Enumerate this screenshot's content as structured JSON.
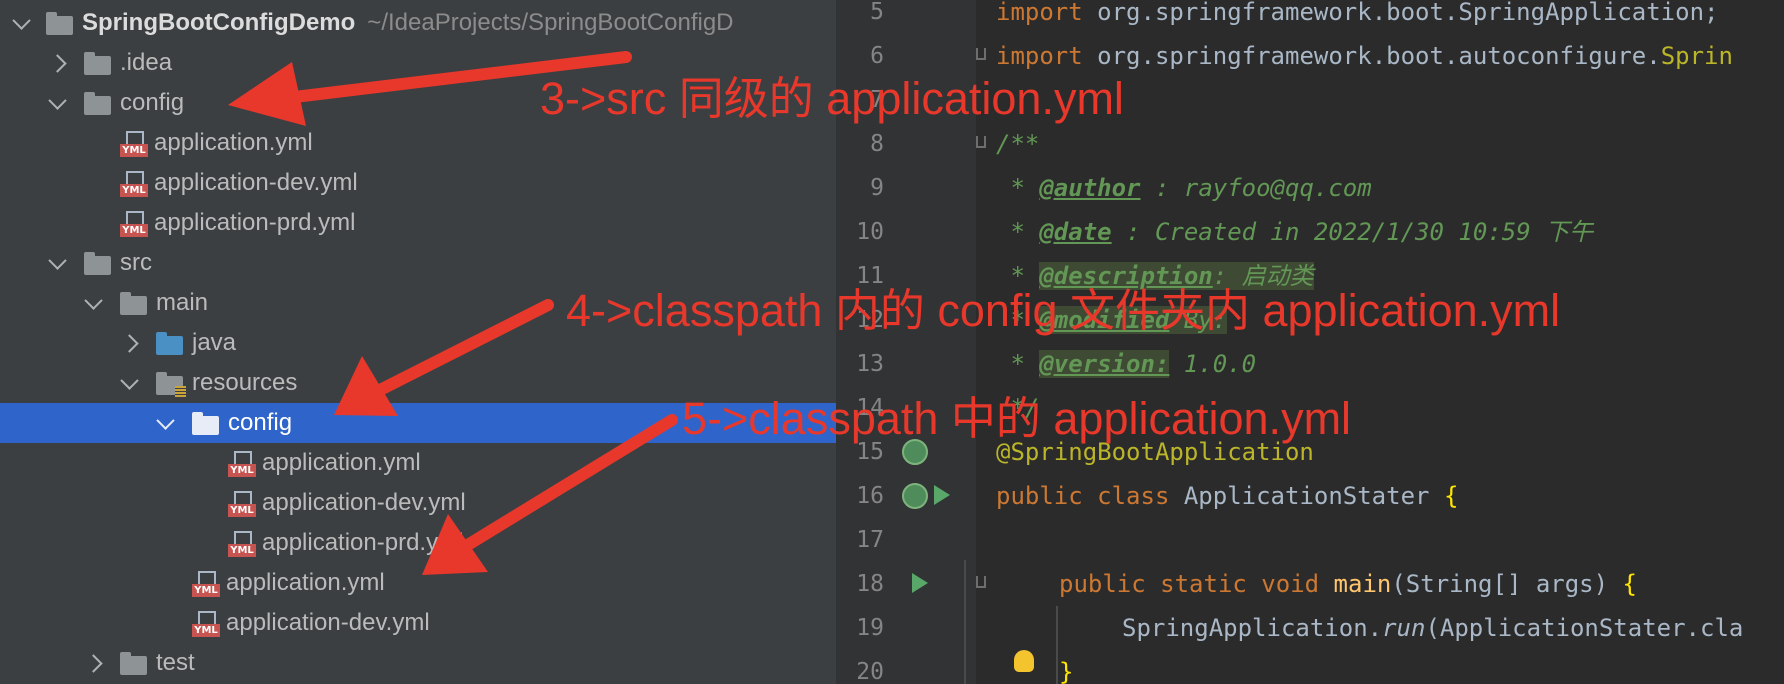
{
  "project_tree": {
    "root": {
      "name": "SpringBootConfigDemo",
      "path": "~/IdeaProjects/SpringBootConfigD"
    },
    "items": [
      {
        "label": ".idea"
      },
      {
        "label": "config"
      },
      {
        "label": "application.yml"
      },
      {
        "label": "application-dev.yml"
      },
      {
        "label": "application-prd.yml"
      },
      {
        "label": "src"
      },
      {
        "label": "main"
      },
      {
        "label": "java"
      },
      {
        "label": "resources"
      },
      {
        "label": "config"
      },
      {
        "label": "application.yml"
      },
      {
        "label": "application-dev.yml"
      },
      {
        "label": "application-prd.yml"
      },
      {
        "label": "application.yml"
      },
      {
        "label": "application-dev.yml"
      },
      {
        "label": "test"
      }
    ]
  },
  "editor": {
    "line_numbers": [
      "5",
      "6",
      "7",
      "8",
      "9",
      "10",
      "11",
      "12",
      "13",
      "14",
      "15",
      "16",
      "17",
      "18",
      "19",
      "20"
    ],
    "lines": {
      "l5a": "import ",
      "l5b": "org.springframework.boot.SpringApplication;",
      "l6a": "import ",
      "l6b": "org.springframework.boot.autoconfigure.",
      "l6c": "Sprin",
      "l8": "/**",
      "l9a": " * ",
      "l9b": "@author",
      "l9c": " : rayfoo@qq.com",
      "l10a": " * ",
      "l10b": "@date",
      "l10c": " : Created in 2022/1/30 10:59 下午",
      "l11a": " * ",
      "l11b": "@description",
      "l11c": ": 启动类",
      "l12a": " * ",
      "l12b": "@modified",
      "l12c": " By:",
      "l13a": " * ",
      "l13b": "@version:",
      "l13c": " 1.0.0",
      "l14": " */",
      "l15": "@SpringBootApplication",
      "l16a": "public class ",
      "l16b": "ApplicationStater ",
      "l16c": "{",
      "l18a": "public static void ",
      "l18b": "main",
      "l18c": "(String[] args) ",
      "l18d": "{",
      "l19a": "SpringApplication.",
      "l19b": "run",
      "l19c": "(ApplicationStater.cla",
      "l20": "}"
    }
  },
  "annotations": {
    "note3": "3->src 同级的 application.yml",
    "note4": "4->classpath 内的 config 文件夹内 application.yml",
    "note5": "5->classpath 中的 application.yml"
  },
  "colors": {
    "annotation": "#e8382b",
    "selection": "#2f65ca",
    "tree_bg": "#3c3f41",
    "editor_bg": "#2b2b2b"
  }
}
